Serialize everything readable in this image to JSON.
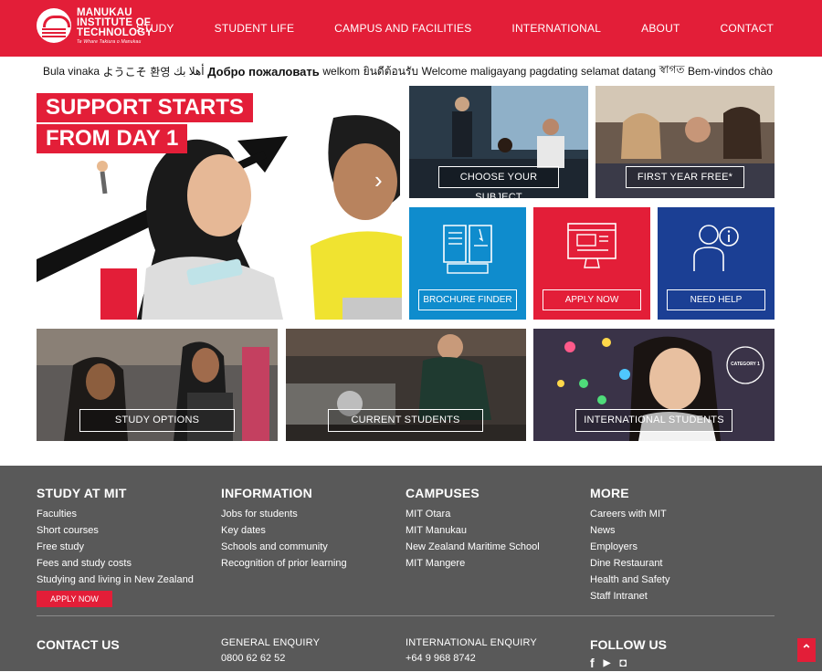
{
  "header": {
    "logo": {
      "line1": "MANUKAU",
      "line2": "INSTITUTE OF",
      "line3": "TECHNOLOGY",
      "tagline": "Te Whare Takiura o Manukau"
    },
    "nav": [
      {
        "label": "STUDY"
      },
      {
        "label": "STUDENT LIFE"
      },
      {
        "label": "CAMPUS AND FACILITIES"
      },
      {
        "label": "INTERNATIONAL"
      },
      {
        "label": "ABOUT"
      },
      {
        "label": "CONTACT"
      }
    ]
  },
  "welcome": [
    "Bula vinaka",
    "ようこそ",
    "환영",
    "أهلا بك",
    "Добро пожаловать",
    "welkom",
    "ยินดีต้อนรับ",
    "Welcome",
    "maligayang pagdating",
    "selamat datang",
    "স্বাগত",
    "Bem-vindos",
    "chào"
  ],
  "hero": {
    "line1": "SUPPORT STARTS",
    "line2": "FROM DAY 1"
  },
  "tiles": {
    "choose_subject": "CHOOSE YOUR SUBJECT",
    "first_year_free": "FIRST YEAR FREE*",
    "brochure_finder": "BROCHURE FINDER",
    "apply_now": "APPLY NOW",
    "need_help": "NEED HELP",
    "study_options": "STUDY OPTIONS",
    "current_students": "CURRENT STUDENTS",
    "international_students": "INTERNATIONAL STUDENTS",
    "category_badge": "CATEGORY 1"
  },
  "colors": {
    "brand_red": "#e31e38",
    "blue": "#0f8ccd",
    "navy": "#1b3f94",
    "footer": "#595959"
  },
  "footer": {
    "study": {
      "title": "STUDY AT MIT",
      "links": [
        "Faculties",
        "Short courses",
        "Free study",
        "Fees and study costs",
        "Studying and living in New Zealand"
      ],
      "apply": "APPLY NOW"
    },
    "information": {
      "title": "INFORMATION",
      "links": [
        "Jobs for students",
        "Key dates",
        "Schools and community",
        "Recognition of prior learning"
      ]
    },
    "campuses": {
      "title": "CAMPUSES",
      "links": [
        "MIT Otara",
        "MIT Manukau",
        "New Zealand Maritime School",
        "MIT Mangere"
      ]
    },
    "more": {
      "title": "MORE",
      "links": [
        "Careers with MIT",
        "News",
        "Employers",
        "Dine Restaurant",
        "Health and Safety",
        "Staff Intranet"
      ]
    },
    "contact": {
      "title": "CONTACT US"
    },
    "general": {
      "label": "GENERAL ENQUIRY",
      "value": "0800 62 62 52"
    },
    "international": {
      "label": "INTERNATIONAL ENQUIRY",
      "value": "+64 9 968 8742"
    },
    "follow": {
      "title": "FOLLOW US",
      "icons": [
        "facebook-icon",
        "youtube-icon",
        "instagram-icon"
      ]
    }
  }
}
